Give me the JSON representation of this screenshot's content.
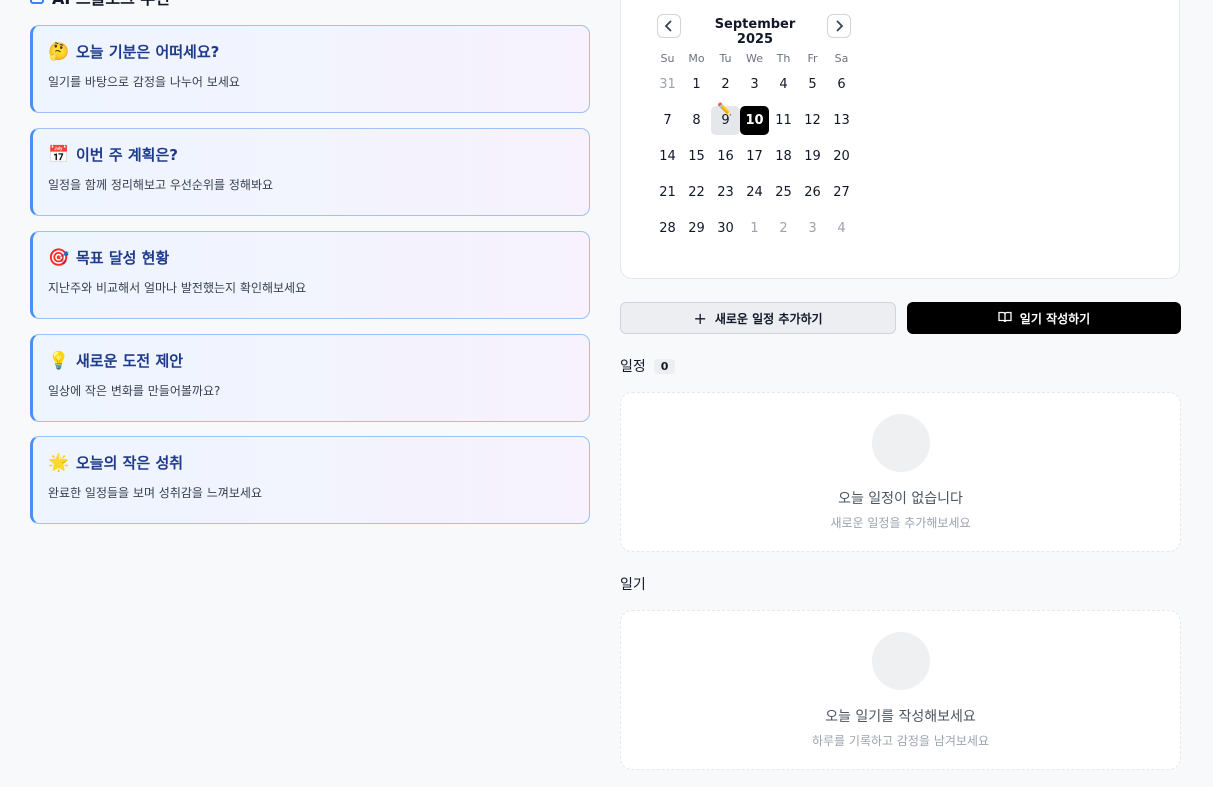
{
  "recommendations": {
    "header": "AI 스몰토크 추천",
    "items": [
      {
        "emoji": "🤔",
        "title": "오늘 기분은 어떠세요?",
        "desc": "일기를 바탕으로 감정을 나누어 보세요"
      },
      {
        "emoji": "📅",
        "title": "이번 주 계획은?",
        "desc": "일정을 함께 정리해보고 우선순위를 정해봐요"
      },
      {
        "emoji": "🎯",
        "title": "목표 달성 현황",
        "desc": "지난주와 비교해서 얼마나 발전했는지 확인해보세요"
      },
      {
        "emoji": "💡",
        "title": "새로운 도전 제안",
        "desc": "일상에 작은 변화를 만들어볼까요?"
      },
      {
        "emoji": "🌟",
        "title": "오늘의 작은 성취",
        "desc": "완료한 일정들을 보며 성취감을 느껴보세요"
      }
    ]
  },
  "calendar": {
    "month_label": "September 2025",
    "prev_icon": "chevron-left-icon",
    "next_icon": "chevron-right-icon",
    "weekdays": [
      "Su",
      "Mo",
      "Tu",
      "We",
      "Th",
      "Fr",
      "Sa"
    ],
    "weeks": [
      [
        {
          "d": "31",
          "o": true
        },
        {
          "d": "1"
        },
        {
          "d": "2"
        },
        {
          "d": "3"
        },
        {
          "d": "4"
        },
        {
          "d": "5"
        },
        {
          "d": "6"
        }
      ],
      [
        {
          "d": "7"
        },
        {
          "d": "8"
        },
        {
          "d": "9",
          "selected": true,
          "mark": true
        },
        {
          "d": "10",
          "today": true
        },
        {
          "d": "11"
        },
        {
          "d": "12"
        },
        {
          "d": "13"
        }
      ],
      [
        {
          "d": "14"
        },
        {
          "d": "15"
        },
        {
          "d": "16"
        },
        {
          "d": "17"
        },
        {
          "d": "18"
        },
        {
          "d": "19"
        },
        {
          "d": "20"
        }
      ],
      [
        {
          "d": "21"
        },
        {
          "d": "22"
        },
        {
          "d": "23"
        },
        {
          "d": "24"
        },
        {
          "d": "25"
        },
        {
          "d": "26"
        },
        {
          "d": "27"
        }
      ],
      [
        {
          "d": "28"
        },
        {
          "d": "29"
        },
        {
          "d": "30"
        },
        {
          "d": "1",
          "o": true
        },
        {
          "d": "2",
          "o": true
        },
        {
          "d": "3",
          "o": true
        },
        {
          "d": "4",
          "o": true
        }
      ]
    ]
  },
  "actions": {
    "add_schedule": "새로운 일정 추가하기",
    "write_diary": "일기 작성하기"
  },
  "schedule": {
    "heading": "일정",
    "count": "0",
    "empty_title": "오늘 일정이 없습니다",
    "empty_sub": "새로운 일정을 추가해보세요"
  },
  "diary": {
    "heading": "일기",
    "empty_title": "오늘 일기를 작성해보세요",
    "empty_sub": "하루를 기록하고 감정을 남겨보세요"
  },
  "colors": {
    "accent": "#4c8ff0",
    "today_bg": "#000000",
    "card_border": "#9cc1f5"
  }
}
